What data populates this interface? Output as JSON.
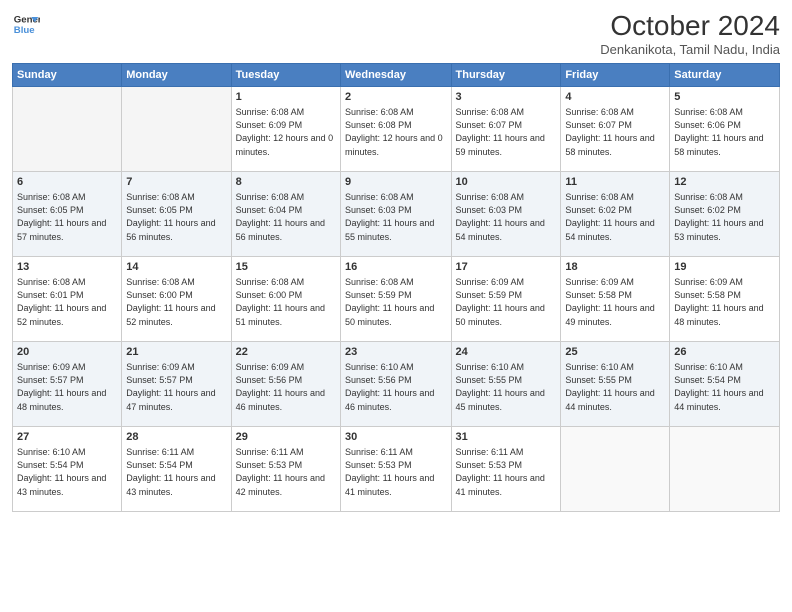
{
  "header": {
    "logo_line1": "General",
    "logo_line2": "Blue",
    "month_title": "October 2024",
    "subtitle": "Denkanikota, Tamil Nadu, India"
  },
  "days_of_week": [
    "Sunday",
    "Monday",
    "Tuesday",
    "Wednesday",
    "Thursday",
    "Friday",
    "Saturday"
  ],
  "weeks": [
    [
      {
        "day": "",
        "empty": true
      },
      {
        "day": "",
        "empty": true
      },
      {
        "day": "1",
        "sunrise": "6:08 AM",
        "sunset": "6:09 PM",
        "daylight": "12 hours and 0 minutes."
      },
      {
        "day": "2",
        "sunrise": "6:08 AM",
        "sunset": "6:08 PM",
        "daylight": "12 hours and 0 minutes."
      },
      {
        "day": "3",
        "sunrise": "6:08 AM",
        "sunset": "6:07 PM",
        "daylight": "11 hours and 59 minutes."
      },
      {
        "day": "4",
        "sunrise": "6:08 AM",
        "sunset": "6:07 PM",
        "daylight": "11 hours and 58 minutes."
      },
      {
        "day": "5",
        "sunrise": "6:08 AM",
        "sunset": "6:06 PM",
        "daylight": "11 hours and 58 minutes."
      }
    ],
    [
      {
        "day": "6",
        "sunrise": "6:08 AM",
        "sunset": "6:05 PM",
        "daylight": "11 hours and 57 minutes."
      },
      {
        "day": "7",
        "sunrise": "6:08 AM",
        "sunset": "6:05 PM",
        "daylight": "11 hours and 56 minutes."
      },
      {
        "day": "8",
        "sunrise": "6:08 AM",
        "sunset": "6:04 PM",
        "daylight": "11 hours and 56 minutes."
      },
      {
        "day": "9",
        "sunrise": "6:08 AM",
        "sunset": "6:03 PM",
        "daylight": "11 hours and 55 minutes."
      },
      {
        "day": "10",
        "sunrise": "6:08 AM",
        "sunset": "6:03 PM",
        "daylight": "11 hours and 54 minutes."
      },
      {
        "day": "11",
        "sunrise": "6:08 AM",
        "sunset": "6:02 PM",
        "daylight": "11 hours and 54 minutes."
      },
      {
        "day": "12",
        "sunrise": "6:08 AM",
        "sunset": "6:02 PM",
        "daylight": "11 hours and 53 minutes."
      }
    ],
    [
      {
        "day": "13",
        "sunrise": "6:08 AM",
        "sunset": "6:01 PM",
        "daylight": "11 hours and 52 minutes."
      },
      {
        "day": "14",
        "sunrise": "6:08 AM",
        "sunset": "6:00 PM",
        "daylight": "11 hours and 52 minutes."
      },
      {
        "day": "15",
        "sunrise": "6:08 AM",
        "sunset": "6:00 PM",
        "daylight": "11 hours and 51 minutes."
      },
      {
        "day": "16",
        "sunrise": "6:08 AM",
        "sunset": "5:59 PM",
        "daylight": "11 hours and 50 minutes."
      },
      {
        "day": "17",
        "sunrise": "6:09 AM",
        "sunset": "5:59 PM",
        "daylight": "11 hours and 50 minutes."
      },
      {
        "day": "18",
        "sunrise": "6:09 AM",
        "sunset": "5:58 PM",
        "daylight": "11 hours and 49 minutes."
      },
      {
        "day": "19",
        "sunrise": "6:09 AM",
        "sunset": "5:58 PM",
        "daylight": "11 hours and 48 minutes."
      }
    ],
    [
      {
        "day": "20",
        "sunrise": "6:09 AM",
        "sunset": "5:57 PM",
        "daylight": "11 hours and 48 minutes."
      },
      {
        "day": "21",
        "sunrise": "6:09 AM",
        "sunset": "5:57 PM",
        "daylight": "11 hours and 47 minutes."
      },
      {
        "day": "22",
        "sunrise": "6:09 AM",
        "sunset": "5:56 PM",
        "daylight": "11 hours and 46 minutes."
      },
      {
        "day": "23",
        "sunrise": "6:10 AM",
        "sunset": "5:56 PM",
        "daylight": "11 hours and 46 minutes."
      },
      {
        "day": "24",
        "sunrise": "6:10 AM",
        "sunset": "5:55 PM",
        "daylight": "11 hours and 45 minutes."
      },
      {
        "day": "25",
        "sunrise": "6:10 AM",
        "sunset": "5:55 PM",
        "daylight": "11 hours and 44 minutes."
      },
      {
        "day": "26",
        "sunrise": "6:10 AM",
        "sunset": "5:54 PM",
        "daylight": "11 hours and 44 minutes."
      }
    ],
    [
      {
        "day": "27",
        "sunrise": "6:10 AM",
        "sunset": "5:54 PM",
        "daylight": "11 hours and 43 minutes."
      },
      {
        "day": "28",
        "sunrise": "6:11 AM",
        "sunset": "5:54 PM",
        "daylight": "11 hours and 43 minutes."
      },
      {
        "day": "29",
        "sunrise": "6:11 AM",
        "sunset": "5:53 PM",
        "daylight": "11 hours and 42 minutes."
      },
      {
        "day": "30",
        "sunrise": "6:11 AM",
        "sunset": "5:53 PM",
        "daylight": "11 hours and 41 minutes."
      },
      {
        "day": "31",
        "sunrise": "6:11 AM",
        "sunset": "5:53 PM",
        "daylight": "11 hours and 41 minutes."
      },
      {
        "day": "",
        "empty": true
      },
      {
        "day": "",
        "empty": true
      }
    ]
  ]
}
